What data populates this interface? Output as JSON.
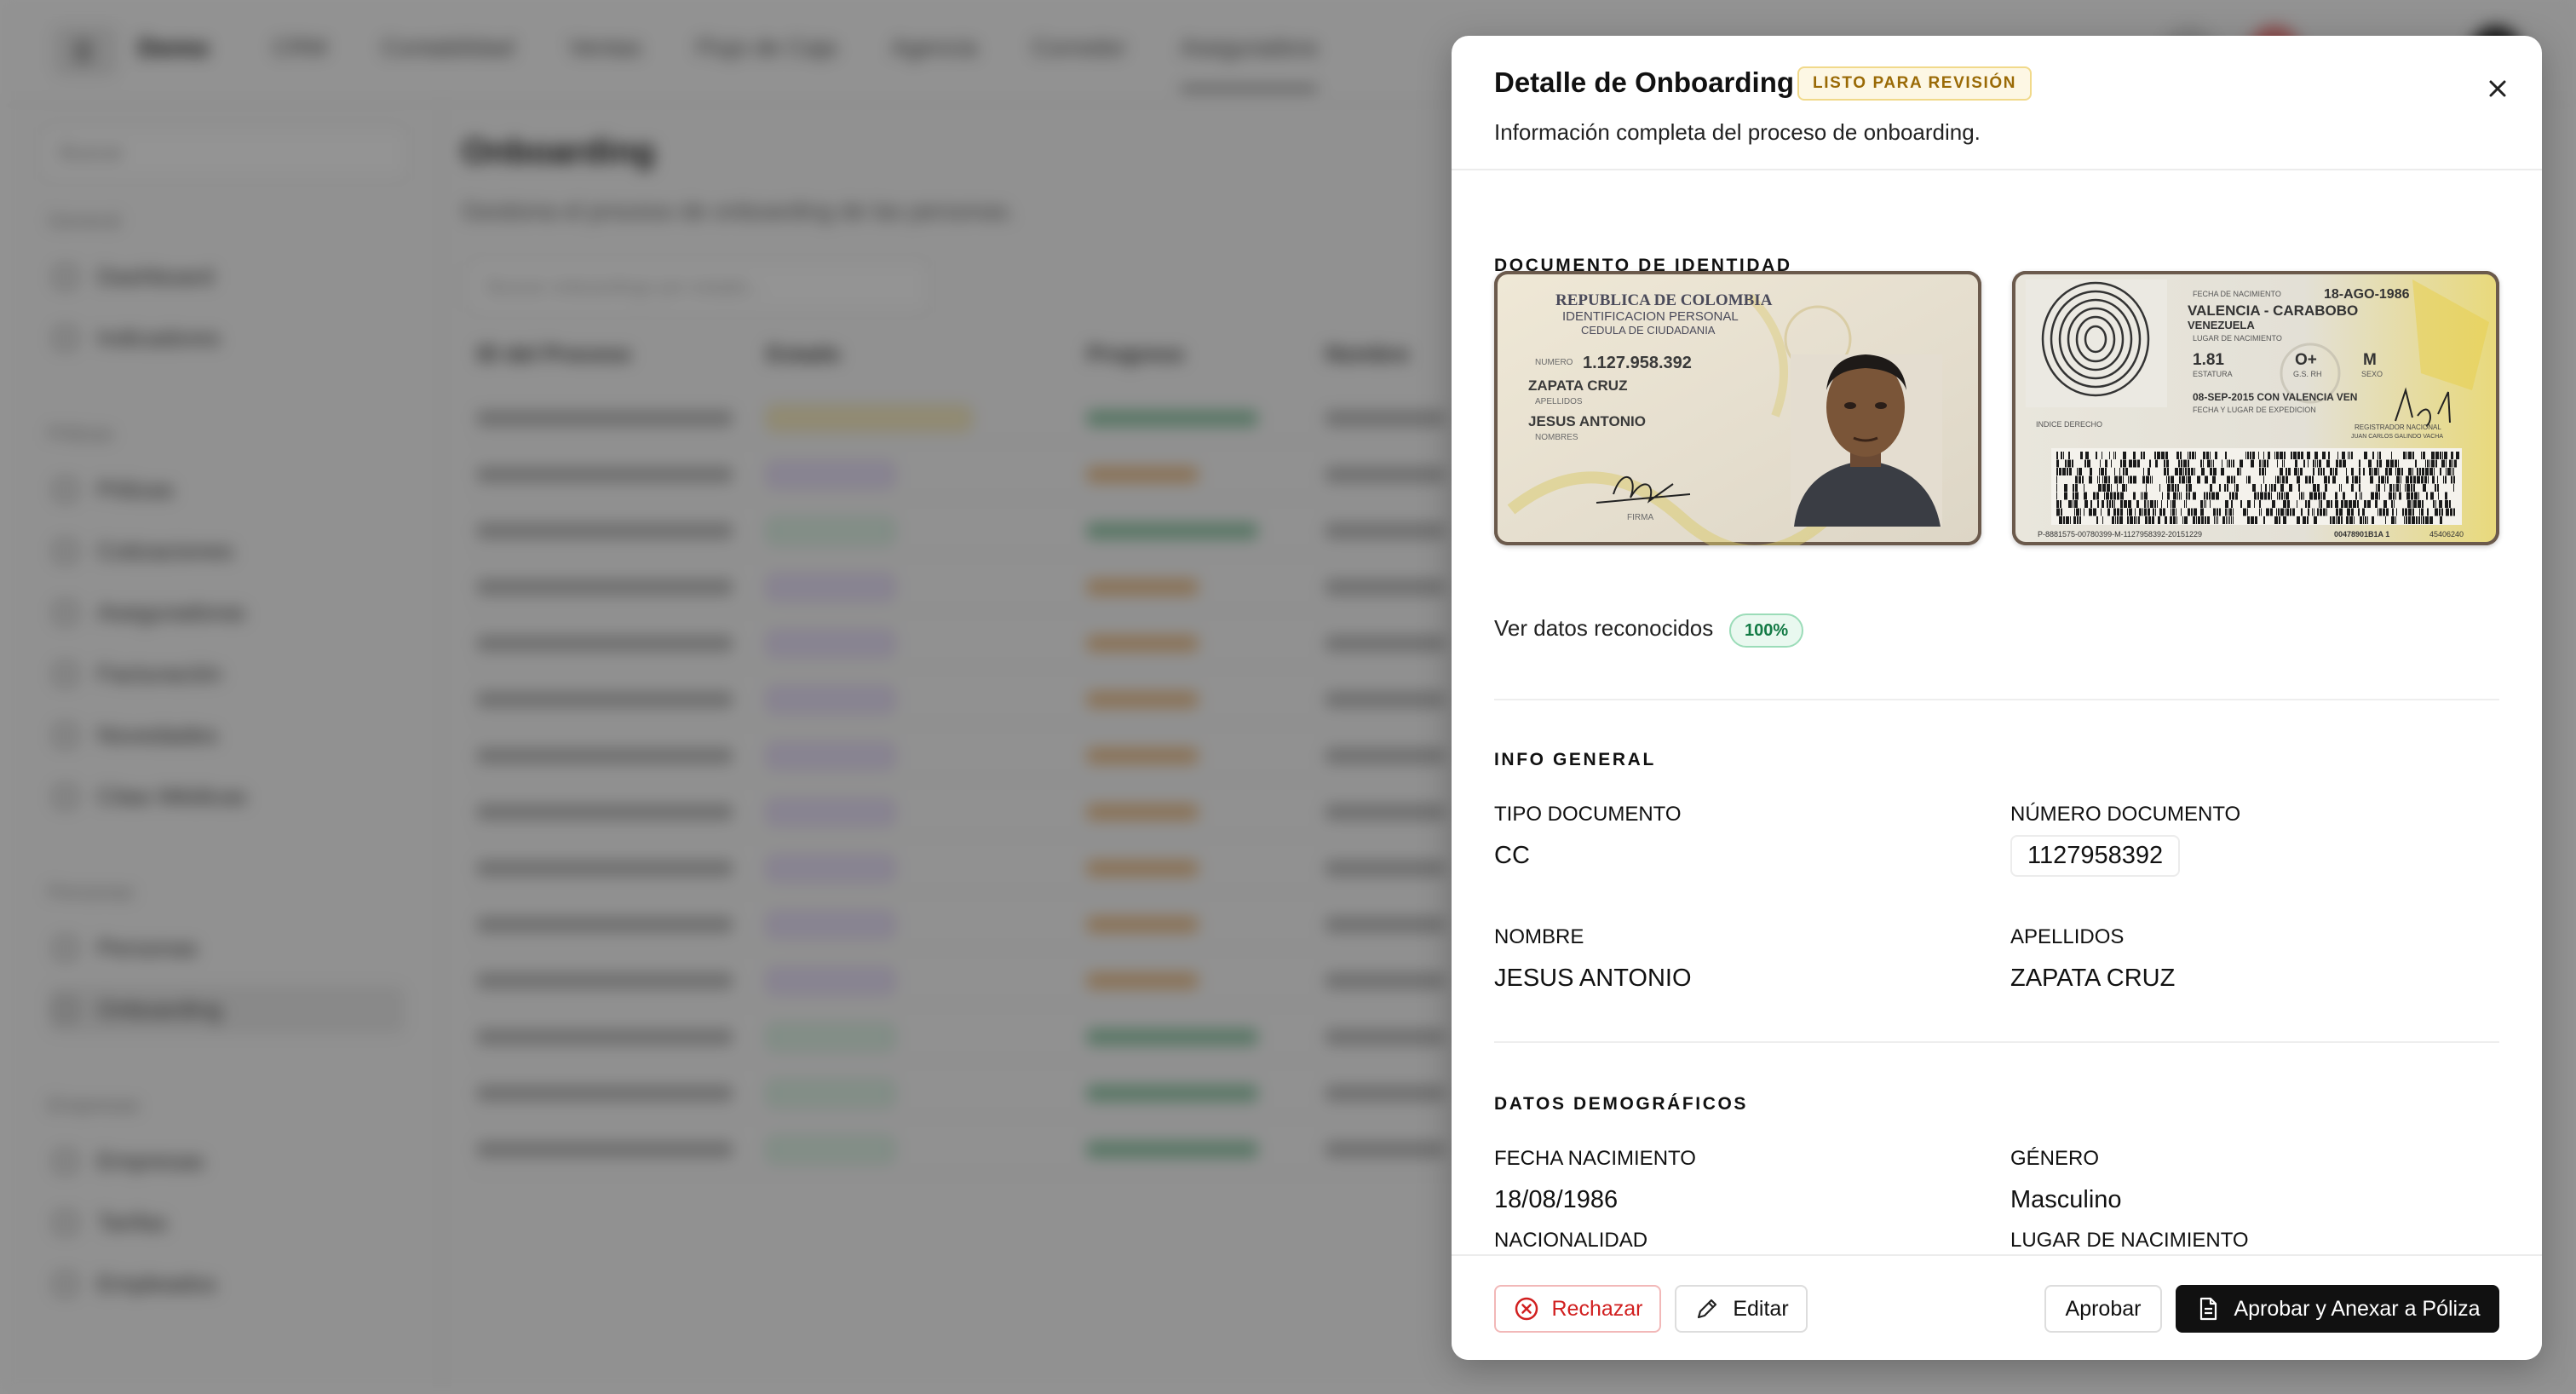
{
  "app": {
    "brand": "Demo",
    "nav": [
      "CRM",
      "Contabilidad",
      "Ventas",
      "Flujo de Caja",
      "Agencia",
      "Corredor",
      "Aseguradora"
    ],
    "sidebar": {
      "search_placeholder": "Buscar",
      "sections": [
        {
          "title": "General",
          "items": [
            "Dashboard",
            "Indicadores"
          ]
        },
        {
          "title": "Pólizas",
          "items": [
            "Pólizas",
            "Cotizaciones",
            "Aseguradoras",
            "Facturación",
            "Novedades",
            "Citas Médicas"
          ]
        },
        {
          "title": "Personas",
          "items": [
            "Personas",
            "Onboarding"
          ]
        },
        {
          "title": "Empresas",
          "items": [
            "Empresas",
            "Tarifas",
            "Empleados"
          ]
        }
      ]
    },
    "main": {
      "title": "Onboarding",
      "subtitle": "Gestiona el proceso de onboarding de las personas.",
      "filter_placeholder": "Buscar onboardings por estado...",
      "columns": [
        "ID del Proceso",
        "Estado",
        "Progreso",
        "Nombre"
      ]
    }
  },
  "modal": {
    "title": "Detalle de Onboarding",
    "status_badge": "LISTO PARA REVISIÓN",
    "description": "Información completa del proceso de onboarding.",
    "close_icon": "close-icon",
    "sections": {
      "document": {
        "label": "DOCUMENTO DE IDENTIDAD",
        "front": {
          "country": "REPUBLICA DE COLOMBIA",
          "line2": "IDENTIFICACION PERSONAL",
          "line3": "CEDULA DE CIUDADANIA",
          "numero_label": "NUMERO",
          "numero": "1.127.958.392",
          "apellidos": "ZAPATA CRUZ",
          "apellidos_label": "APELLIDOS",
          "nombres": "JESUS ANTONIO",
          "nombres_label": "NOMBRES",
          "firma_label": "FIRMA"
        },
        "back": {
          "fecha_nac_label": "FECHA DE NACIMIENTO",
          "fecha_nac": "18-AGO-1986",
          "lugar": "VALENCIA - CARABOBO",
          "pais": "VENEZUELA",
          "lugar_label": "LUGAR DE NACIMIENTO",
          "estatura": "1.81",
          "estatura_label": "ESTATURA",
          "rh": "O+",
          "rh_label": "G.S. RH",
          "sexo": "M",
          "sexo_label": "SEXO",
          "expedicion": "08-SEP-2015 CON VALENCIA VEN",
          "expedicion_label": "FECHA Y LUGAR DE EXPEDICION",
          "indice": "INDICE DERECHO",
          "registrador": "REGISTRADOR NACIONAL",
          "registrador_name": "JUAN CARLOS GALINDO VACHA",
          "mrz": "P-8881575-00780399-M-1127958392-20151229",
          "code1": "00478901B1A 1",
          "code2": "45406240"
        },
        "recognized_label": "Ver datos reconocidos",
        "recognized_pct": "100%"
      },
      "general": {
        "label": "INFO GENERAL",
        "tipo_label": "TIPO DOCUMENTO",
        "tipo_value": "CC",
        "numero_label": "NÚMERO DOCUMENTO",
        "numero_value": "1127958392",
        "nombre_label": "NOMBRE",
        "nombre_value": "JESUS ANTONIO",
        "apellidos_label": "APELLIDOS",
        "apellidos_value": "ZAPATA CRUZ"
      },
      "demographic": {
        "label": "DATOS DEMOGRÁFICOS",
        "fecha_label": "FECHA NACIMIENTO",
        "fecha_value": "18/08/1986",
        "genero_label": "GÉNERO",
        "genero_value": "Masculino",
        "nacionalidad_label": "NACIONALIDAD",
        "lugar_label": "LUGAR DE NACIMIENTO"
      }
    },
    "footer": {
      "reject": "Rechazar",
      "edit": "Editar",
      "approve": "Aprobar",
      "approve_annex": "Aprobar y Anexar a Póliza"
    }
  }
}
